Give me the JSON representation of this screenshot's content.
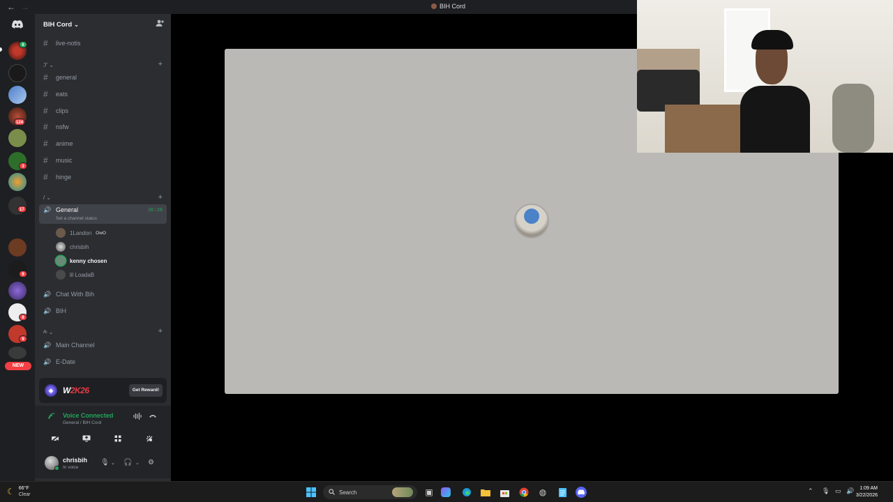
{
  "window": {
    "title": "BIH Cord",
    "nav_back": "←",
    "nav_forward": "→"
  },
  "server": {
    "name": "BIH Cord",
    "chevron": "⌄",
    "add_member_icon": "person-add-icon"
  },
  "rail": {
    "badges": [
      "6",
      "124",
      "3",
      "17",
      "9",
      "8",
      "9"
    ],
    "new_label": "NEW"
  },
  "channels": {
    "top": [
      {
        "label": "live-notis"
      }
    ],
    "category1": {
      "name": "ፓ",
      "items": [
        {
          "label": "general"
        },
        {
          "label": "eats"
        },
        {
          "label": "clips"
        },
        {
          "label": "nsfw"
        },
        {
          "label": "anime"
        },
        {
          "label": "music"
        },
        {
          "label": "hinge"
        }
      ]
    },
    "category2": {
      "name": "/"
    },
    "voice_active": {
      "label": "General",
      "timer": "36:28",
      "status": "Set a channel status"
    },
    "voice_users": [
      {
        "name": "1Landon",
        "tag": "OwO"
      },
      {
        "name": "chrisbih"
      },
      {
        "name": "kenny chosen"
      },
      {
        "name": "lil LoadaB"
      }
    ],
    "voice_more": [
      {
        "label": "Chat With Bih"
      },
      {
        "label": "BIH"
      }
    ],
    "category3": {
      "name": "ሉ"
    },
    "voice_more2": [
      {
        "label": "Main Channel"
      },
      {
        "label": "E-Date"
      }
    ]
  },
  "promo": {
    "brand": "W",
    "brand_accent": "2K26",
    "button": "Get Reward!"
  },
  "voice_panel": {
    "title": "Voice Connected",
    "subtitle": "General / BIH Cord"
  },
  "user": {
    "name": "chrisbih",
    "status": "In voice"
  },
  "taskbar": {
    "weather_temp": "66°F",
    "weather_desc": "Clear",
    "search_placeholder": "Search",
    "time": "1:09 AM",
    "date": "3/22/2026"
  }
}
